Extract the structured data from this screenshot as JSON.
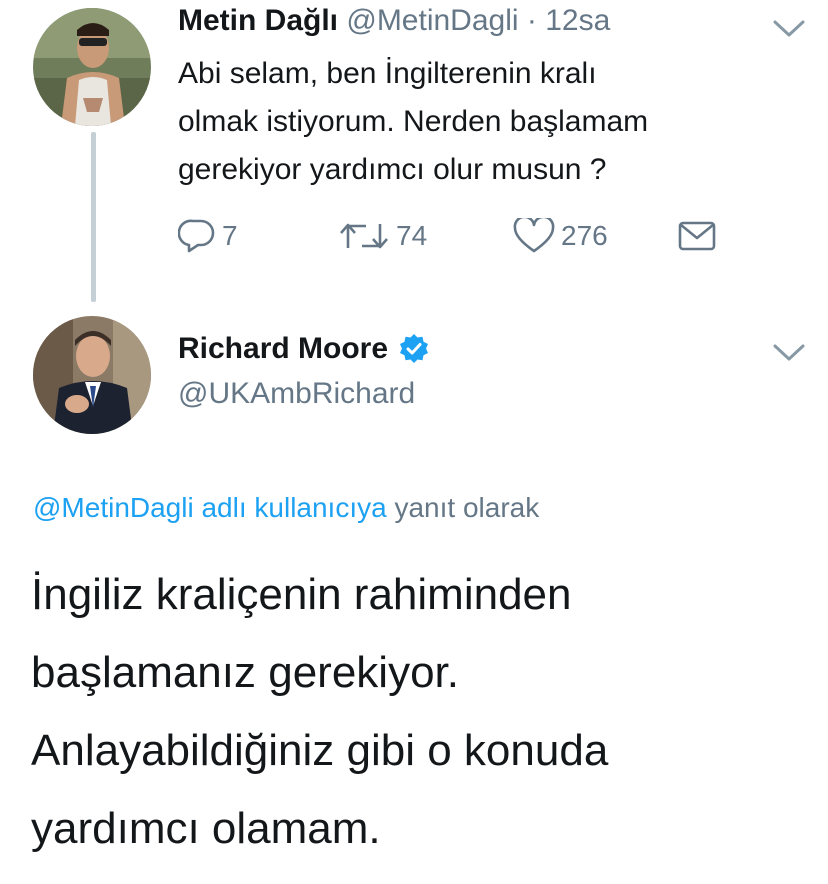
{
  "tweet1": {
    "name": "Metin Dağlı",
    "handle": "@MetinDagli",
    "time": "· 12sa",
    "text_lines": [
      "Abi selam, ben İngilterenin kralı",
      "olmak istiyorum. Nerden başlamam",
      "gerekiyor yardımcı olur musun ?"
    ],
    "reply_count": "7",
    "retweet_count": "74",
    "like_count": "276"
  },
  "tweet2": {
    "name": "Richard Moore",
    "handle": "@UKAmbRichard",
    "reply_to_mention": "@MetinDagli adlı kullanıcıya",
    "reply_to_suffix": "yanıt olarak",
    "text_lines": [
      "İngiliz kraliçenin rahiminden",
      "başlamanız gerekiyor.",
      "Anlayabildiğiniz gibi o konuda",
      "yardımcı olamam."
    ]
  },
  "icons": {
    "reply": "reply-icon",
    "retweet": "retweet-icon",
    "like": "heart-icon",
    "dm": "envelope-icon",
    "chevron": "chevron-down-icon",
    "verified": "verified-badge-icon"
  },
  "colors": {
    "accent": "#1da1f2",
    "muted": "#657786",
    "text": "#14171a",
    "thread_line": "#c4cfd6"
  }
}
